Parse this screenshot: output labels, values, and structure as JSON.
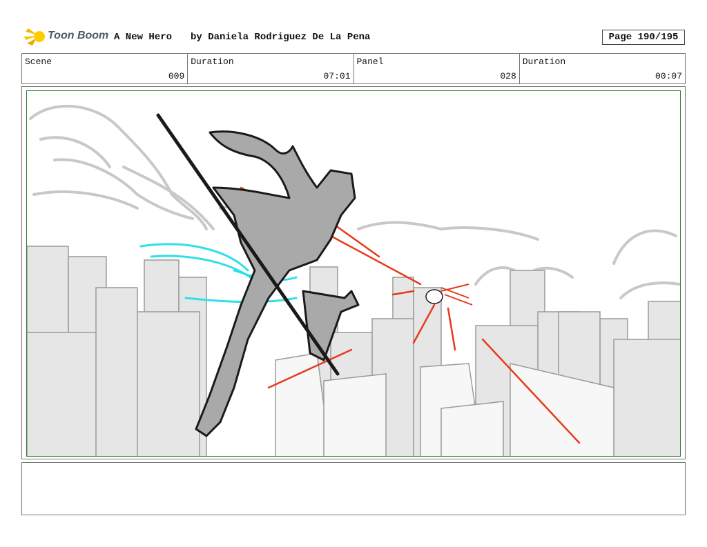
{
  "header": {
    "logo_text": "Toon Boom",
    "title": "A New Hero",
    "author": "by Daniela Rodriguez De La Pena",
    "page": "Page 190/195"
  },
  "info": {
    "scene_label": "Scene",
    "scene_value": "009",
    "scene_duration_label": "Duration",
    "scene_duration_value": "07:01",
    "panel_label": "Panel",
    "panel_value": "028",
    "panel_duration_label": "Duration",
    "panel_duration_value": "00:07"
  },
  "colors": {
    "sketch": "#1a1a1a",
    "fill": "#a9a9a9",
    "buildings": "#e6e6e6",
    "speed_lines": "#2fe0e8",
    "laser": "#e8391c",
    "frame": "#2e7d32"
  },
  "notes": ""
}
